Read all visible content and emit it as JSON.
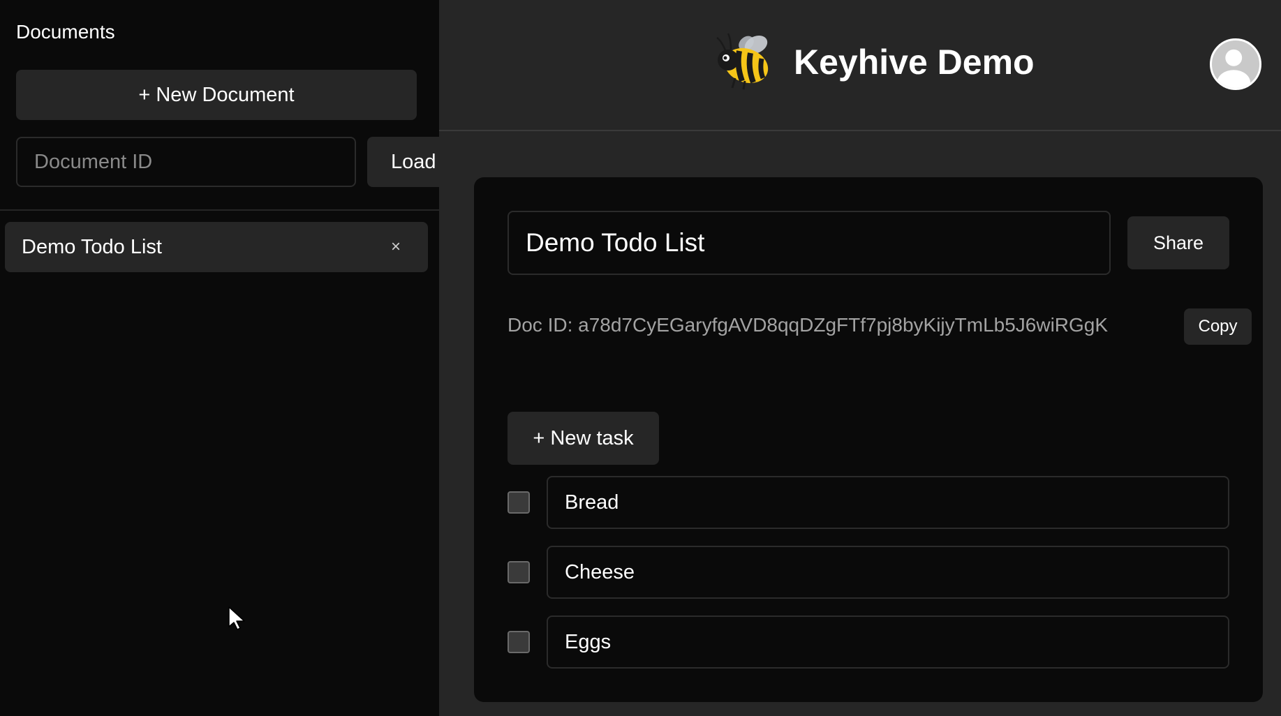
{
  "sidebar": {
    "title": "Documents",
    "new_document_label": "+ New Document",
    "document_id_placeholder": "Document ID",
    "load_label": "Load",
    "documents": [
      {
        "label": "Demo Todo List",
        "close_glyph": "×"
      }
    ]
  },
  "header": {
    "logo_icon": "bee-icon",
    "title": "Keyhive Demo",
    "avatar_icon": "user-avatar-icon"
  },
  "document": {
    "title_value": "Demo Todo List",
    "share_label": "Share",
    "doc_id_text": "Doc ID: a78d7CyEGaryfgAVD8qqDZgFTf7pj8byKijyTmLb5J6wiRGgK",
    "copy_label": "Copy",
    "new_task_label": "+ New task",
    "tasks": [
      {
        "label": "Bread",
        "checked": false
      },
      {
        "label": "Cheese",
        "checked": false
      },
      {
        "label": "Eggs",
        "checked": false
      }
    ]
  },
  "colors": {
    "background": "#0a0a0a",
    "panel": "#262626",
    "text": "#ffffff",
    "muted_text": "#a3a3a3"
  }
}
